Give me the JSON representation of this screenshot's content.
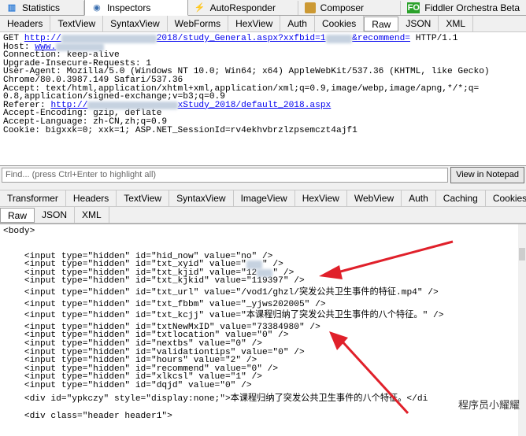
{
  "top_tabs": [
    {
      "label": "Statistics",
      "active": false
    },
    {
      "label": "Inspectors",
      "active": true
    },
    {
      "label": "AutoResponder",
      "active": false
    },
    {
      "label": "Composer",
      "active": false
    },
    {
      "label": "Fiddler Orchestra Beta",
      "active": false
    }
  ],
  "fo_badge": "FO",
  "request_tabs": [
    "Headers",
    "TextView",
    "SyntaxView",
    "WebForms",
    "HexView",
    "Auth",
    "Cookies",
    "Raw",
    "JSON",
    "XML"
  ],
  "request_active_tab": "Raw",
  "request_lines": {
    "l1_pre": "GET ",
    "l1_url_a": "http://",
    "l1_url_b": "2018/study_General.aspx?xxfbid=1",
    "l1_url_c": "&recommend=",
    "l1_post": " HTTP/1.1",
    "l2_pre": "Host: ",
    "l2_url": "www.",
    "l3": "Connection: keep-alive",
    "l4": "Upgrade-Insecure-Requests: 1",
    "l5": "User-Agent: Mozilla/5.0 (Windows NT 10.0; Win64; x64) AppleWebKit/537.36 (KHTML, like Gecko)",
    "l6": "Chrome/80.0.3987.149 Safari/537.36",
    "l7": "Accept: text/html,application/xhtml+xml,application/xml;q=0.9,image/webp,image/apng,*/*;q=",
    "l8": "0.8,application/signed-exchange;v=b3;q=0.9",
    "l9_pre": "Referer: ",
    "l9_url_a": "http://",
    "l9_url_b": "xStudy_2018/default_2018.aspx",
    "l10": "Accept-Encoding: gzip, deflate",
    "l11": "Accept-Language: zh-CN,zh;q=0.9",
    "l12": "Cookie: bigxxk=0; xxk=1; ASP.NET_SessionId=rv4ekhvbrzlzpsemczt4ajf1"
  },
  "find": {
    "placeholder": "Find... (press Ctrl+Enter to highlight all)",
    "button": "View in Notepad"
  },
  "response_tabs": [
    "Transformer",
    "Headers",
    "TextView",
    "SyntaxView",
    "ImageView",
    "HexView",
    "WebView",
    "Auth",
    "Caching",
    "Cookies"
  ],
  "response_sub_tabs": [
    "Raw",
    "JSON",
    "XML"
  ],
  "response_active_tab": "Raw",
  "response_lines": {
    "r0": "<body>",
    "r1": "    <input type=\"hidden\" id=\"hid_now\" value=\"no\" />",
    "r2a": "    <input type=\"hidden\" id=\"txt_xyid\" value=\"",
    "r2b": "\" />",
    "r3a": "    <input type=\"hidden\" id=\"txt_kjid\" value=\"12",
    "r3b": "\" />",
    "r4": "    <input type=\"hidden\" id=\"txt_kjkid\" value=\"119397\" />",
    "r5": "    <input type=\"hidden\" id=\"txt_url\" value=\"/vod1/ghzl/突发公共卫生事件的特征.mp4\" />",
    "r6": "    <input type=\"hidden\" id=\"txt_fbbm\" value=\"_yjws202005\" />",
    "r7": "    <input type=\"hidden\" id=\"txt_kcjj\" value=\"本课程归纳了突发公共卫生事件的八个特征。\" />",
    "r8": "    <input type=\"hidden\" id=\"txtNewMxID\" value=\"73384980\" />",
    "r9": "    <input type=\"hidden\" id=\"txtlocation\" value=\"0\" />",
    "r10": "    <input type=\"hidden\" id=\"nextbs\" value=\"0\" />",
    "r11": "    <input type=\"hidden\" id=\"validationtips\" value=\"0\" />",
    "r12": "    <input type=\"hidden\" id=\"hours\" value=\"2\" />",
    "r13": "    <input type=\"hidden\" id=\"recommend\" value=\"0\" />",
    "r14": "    <input type=\"hidden\" id=\"xlkcsl\" value=\"1\" />",
    "r15": "    <input type=\"hidden\" id=\"dqjd\" value=\"0\" />",
    "r16": "    <div id=\"ypkczy\" style=\"display:none;\">本课程归纳了突发公共卫生事件的八个特征。</di",
    "r17": "    <div class=\"header header1\">"
  },
  "watermark": "程序员小耀耀",
  "colors": {
    "arrow": "#e0202a",
    "link": "#0000ee",
    "tab_bg": "#f0f0f0"
  }
}
